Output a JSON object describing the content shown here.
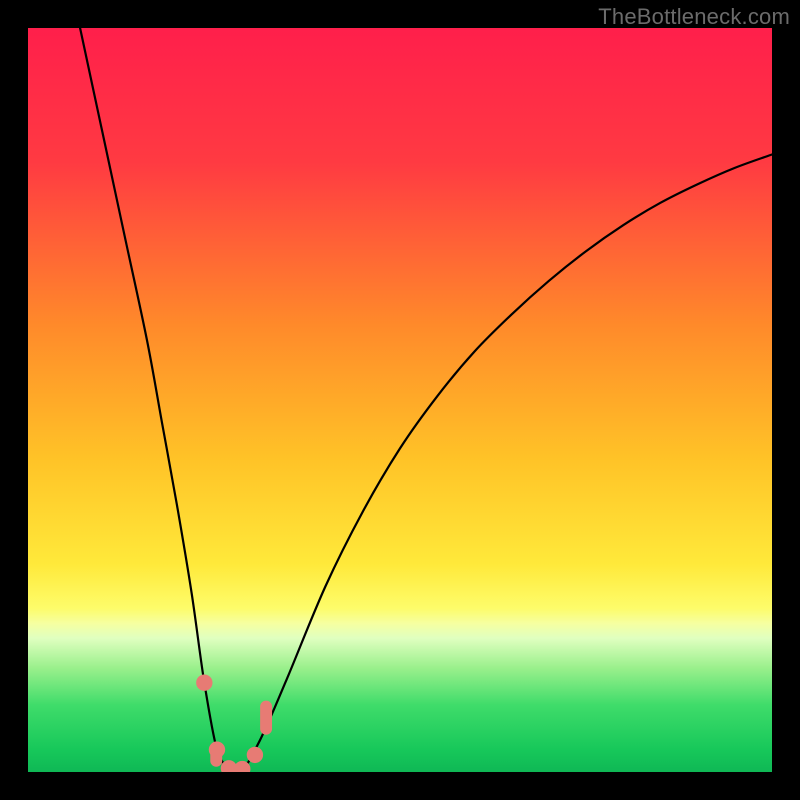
{
  "watermark": "TheBottleneck.com",
  "chart_data": {
    "type": "line",
    "title": "",
    "xlabel": "",
    "ylabel": "",
    "xlim": [
      0,
      100
    ],
    "ylim": [
      0,
      100
    ],
    "gradient_stops": [
      {
        "offset": 0,
        "color": "#ff1f4b"
      },
      {
        "offset": 18,
        "color": "#ff3a42"
      },
      {
        "offset": 40,
        "color": "#ff8a2a"
      },
      {
        "offset": 58,
        "color": "#ffc327"
      },
      {
        "offset": 72,
        "color": "#ffe93a"
      },
      {
        "offset": 78,
        "color": "#fdfc6a"
      },
      {
        "offset": 80,
        "color": "#f6ffa0"
      },
      {
        "offset": 82,
        "color": "#e0ffc0"
      },
      {
        "offset": 86,
        "color": "#9af08c"
      },
      {
        "offset": 91,
        "color": "#3fdc6a"
      },
      {
        "offset": 97,
        "color": "#17c85a"
      },
      {
        "offset": 100,
        "color": "#0fb855"
      }
    ],
    "series": [
      {
        "name": "bottleneck-curve",
        "x": [
          7,
          10,
          13,
          16,
          18,
          20,
          22,
          23.7,
          25.4,
          27,
          28,
          29,
          30,
          32,
          35,
          40,
          45,
          50,
          55,
          60,
          65,
          70,
          75,
          80,
          85,
          90,
          95,
          100
        ],
        "y": [
          100,
          86,
          72,
          58,
          47,
          36,
          24,
          12,
          3,
          0.5,
          0,
          0.5,
          2,
          6,
          13,
          25,
          35,
          43.5,
          50.5,
          56.5,
          61.5,
          66,
          70,
          73.5,
          76.5,
          79,
          81.2,
          83
        ]
      }
    ],
    "markers": [
      {
        "shape": "circle",
        "x": 23.7,
        "y": 12,
        "r": 1.1
      },
      {
        "shape": "circle",
        "x": 25.4,
        "y": 3,
        "r": 1.1
      },
      {
        "shape": "circle",
        "x": 27.0,
        "y": 0.5,
        "r": 1.1
      },
      {
        "shape": "circle",
        "x": 28.8,
        "y": 0.4,
        "r": 1.1
      },
      {
        "shape": "circle",
        "x": 30.5,
        "y": 2.3,
        "r": 1.1
      },
      {
        "shape": "pill",
        "x": 32.0,
        "y": 7.3,
        "w": 1.6,
        "h": 4.6
      },
      {
        "shape": "pill",
        "x": 25.3,
        "y": 2.4,
        "w": 1.6,
        "h": 3.4
      }
    ],
    "marker_color": "#e77b74"
  }
}
